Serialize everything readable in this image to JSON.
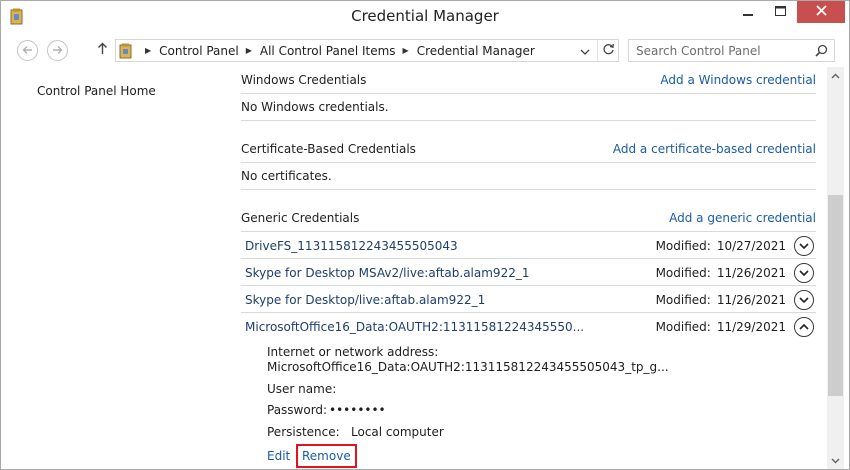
{
  "window": {
    "title": "Credential Manager"
  },
  "address": {
    "crumbs": [
      "Control Panel",
      "All Control Panel Items",
      "Credential Manager"
    ],
    "search_placeholder": "Search Control Panel"
  },
  "sidebar": {
    "home_label": "Control Panel Home"
  },
  "sections": {
    "windows": {
      "title": "Windows Credentials",
      "add_link": "Add a Windows credential",
      "empty_text": "No Windows credentials."
    },
    "certificate": {
      "title": "Certificate-Based Credentials",
      "add_link": "Add a certificate-based credential",
      "empty_text": "No certificates."
    },
    "generic": {
      "title": "Generic Credentials",
      "add_link": "Add a generic credential",
      "items": [
        {
          "name": "DriveFS_113115812243455505043",
          "modified_label": "Modified:",
          "modified": "10/27/2021",
          "expanded": false
        },
        {
          "name": "Skype for Desktop MSAv2/live:aftab.alam922_1",
          "modified_label": "Modified:",
          "modified": "11/26/2021",
          "expanded": false
        },
        {
          "name": "Skype for Desktop/live:aftab.alam922_1",
          "modified_label": "Modified:",
          "modified": "11/26/2021",
          "expanded": false
        },
        {
          "name": "MicrosoftOffice16_Data:OAUTH2:11311581224345550...",
          "modified_label": "Modified:",
          "modified": "11/29/2021",
          "expanded": true
        }
      ]
    }
  },
  "details": {
    "address_label": "Internet or network address:",
    "address_value": "MicrosoftOffice16_Data:OAUTH2:113115812243455505043_tp_g...",
    "username_label": "User name:",
    "password_label": "Password:",
    "password_value": "••••••••",
    "persistence_label": "Persistence:",
    "persistence_value": "Local computer"
  },
  "actions": {
    "edit_label": "Edit",
    "remove_label": "Remove"
  },
  "colors": {
    "link": "#1a5ba6",
    "close_button": "#c7504f",
    "highlight_border": "#e0141e"
  },
  "icons": [
    "credential-manager-icon",
    "minimize-icon",
    "maximize-icon",
    "close-icon",
    "back-arrow-icon",
    "forward-arrow-icon",
    "up-arrow-icon",
    "control-panel-icon",
    "chevron-right-icon",
    "chevron-down-icon",
    "refresh-icon",
    "search-icon",
    "chevron-up-icon"
  ]
}
